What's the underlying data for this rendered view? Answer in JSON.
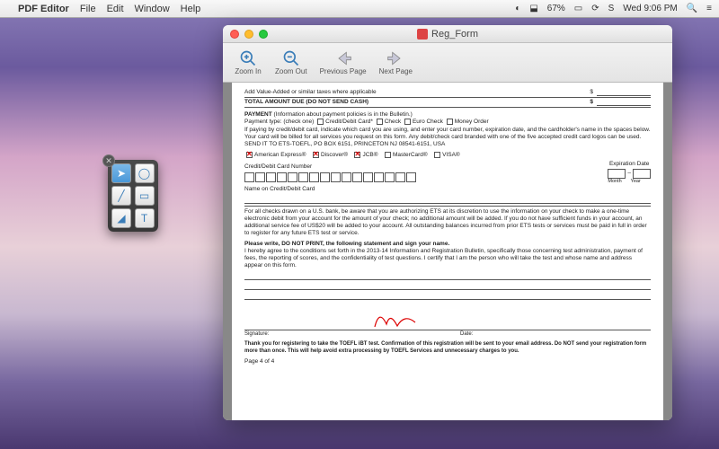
{
  "menubar": {
    "app": "PDF Editor",
    "items": [
      "File",
      "Edit",
      "Window",
      "Help"
    ],
    "battery": "67%",
    "clock": "Wed 9:06 PM"
  },
  "window": {
    "title": "Reg_Form"
  },
  "toolbar": {
    "zoom_in": "Zoom In",
    "zoom_out": "Zoom Out",
    "prev": "Previous Page",
    "next": "Next Page"
  },
  "doc": {
    "line_addvalue": "Add Value-Added or similar taxes where applicable",
    "line_total": "TOTAL AMOUNT DUE (DO NOT SEND CASH)",
    "dollar": "$",
    "payment_hdr": "PAYMENT",
    "payment_note": "(Information about payment policies is in the Bulletin.)",
    "ptype": "Payment type: (check one)",
    "opt_credit": "Credit/Debit Card*",
    "opt_check": "Check",
    "opt_euro": "Euro Check",
    "opt_money": "Money Order",
    "cardnote": "If paying by credit/debit card, indicate which card you are using, and enter your card number, expiration date, and the cardholder's name in the spaces below. Your card will be billed for all services you request on this form. Any debit/check card branded with one of the five accepted credit card logos can be used.",
    "sendto": "SEND IT TO ETS-TOEFL, PO BOX 6151, PRINCETON NJ 08541-6151, USA",
    "cc_amex": "American Express®",
    "cc_disc": "Discover®",
    "cc_jcb": "JCB®",
    "cc_mc": "MasterCard®",
    "cc_visa": "VISA®",
    "ccnum": "Credit/Debit Card Number",
    "expdate": "Expiration Date",
    "month": "Month",
    "year": "Year",
    "nameoncard": "Name on Credit/Debit Card",
    "checks_note": "For all checks drawn on a U.S. bank, be aware that you are authorizing ETS at its discretion to use the information on your check to make a one-time electronic debit from your account for the amount of your check; no additional amount will be added. If you do not have sufficient funds in your account, an additional service fee of US$20 will be added to your account. All outstanding balances incurred from prior ETS tests or services must be paid in full in order to register for any future ETS test or service.",
    "please_write": "Please write, DO NOT PRINT, the following statement and sign your name.",
    "agree": "I hereby agree to the conditions set forth in the 2013-14 Information and Registration Bulletin, specifically those concerning test administration, payment of fees, the reporting of scores, and the confidentiality of test questions. I certify that I am the person who will take the test and whose name and address appear on this form.",
    "sig": "Signature:",
    "date": "Date:",
    "thanks": "Thank you for registering to take the TOEFL iBT test. Confirmation of this registration will be sent to your email address. Do NOT send your registration form more than once. This will help avoid extra processing by TOEFL Services and unnecessary charges to you.",
    "pagenum": "Page 4 of 4"
  }
}
